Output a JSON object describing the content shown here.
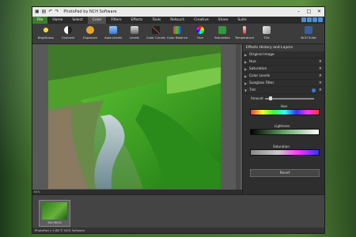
{
  "app": {
    "title": "PhotoPad by NCH Software"
  },
  "menu": [
    "File",
    "Home",
    "Select",
    "Color",
    "Filters",
    "Effects",
    "Tools",
    "Retouch",
    "Creative",
    "Share",
    "Suite"
  ],
  "toolbar": [
    "Brightness",
    "Contrast",
    "Exposure",
    "Auto Levels",
    "Levels",
    "Color Curves",
    "Color Balance",
    "Hue",
    "Saturation",
    "Temperature",
    "Tint",
    "NCH Suite"
  ],
  "panel": {
    "title": "Effects History and Layers",
    "items": [
      "Original Image",
      "Hue",
      "Saturation",
      "Color Levels",
      "Sunglass Filter",
      "Tint"
    ],
    "amount_label": "Amount",
    "hue_label": "Hue",
    "lightness_label": "Lightness",
    "saturation_label": "Saturation",
    "reset_label": "Reset"
  },
  "status": {
    "zoom": "64%"
  },
  "filmstrip": {
    "thumb_label": "38478832"
  },
  "bottom": {
    "text": "PhotoPad v 2.88 © NCH Software"
  },
  "colors": {
    "accent": "#3d7d2d",
    "hue_gradient": "rainbow"
  },
  "icons": {
    "brightness": "sun-icon",
    "contrast": "contrast-icon",
    "hue": "color-wheel-icon"
  }
}
